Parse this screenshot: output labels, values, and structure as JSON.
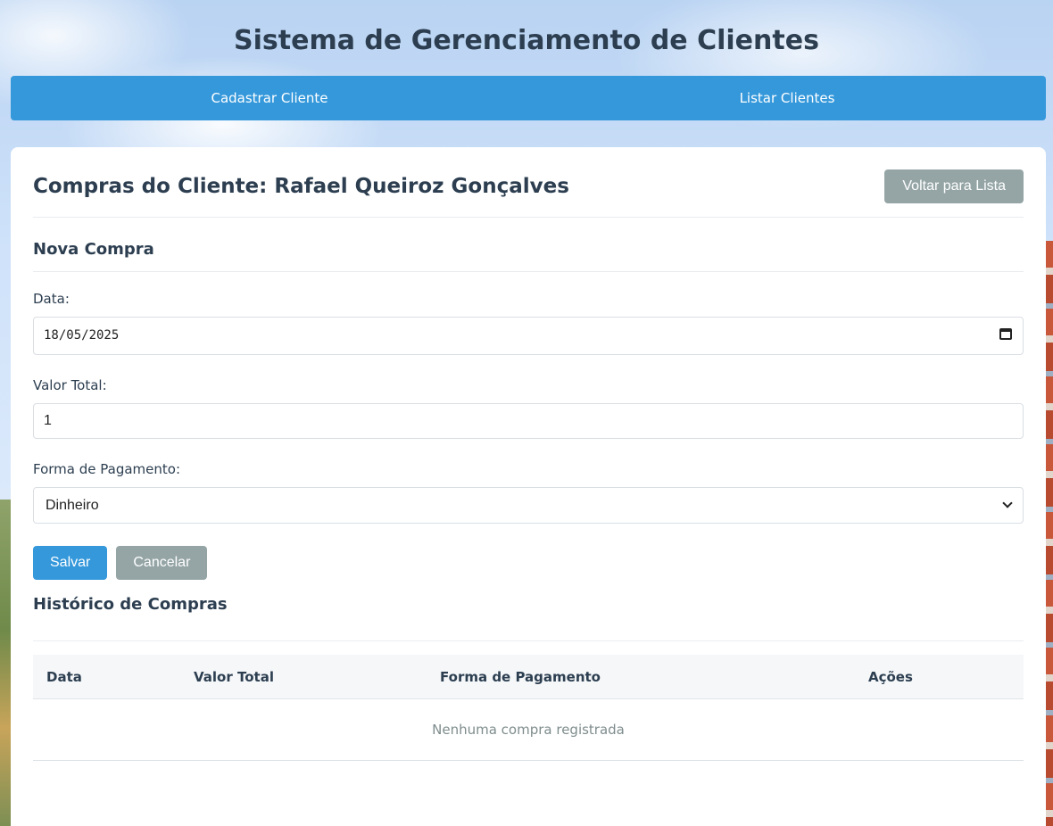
{
  "app": {
    "title": "Sistema de Gerenciamento de Clientes"
  },
  "nav": {
    "items": [
      {
        "label": "Cadastrar Cliente"
      },
      {
        "label": "Listar Clientes"
      }
    ]
  },
  "page": {
    "title": "Compras do Cliente: Rafael Queiroz Gonçalves",
    "back_button": "Voltar para Lista"
  },
  "form": {
    "title": "Nova Compra",
    "date_label": "Data:",
    "date_value": "18/05/2025",
    "total_label": "Valor Total:",
    "total_value": "1",
    "payment_label": "Forma de Pagamento:",
    "payment_value": "Dinheiro",
    "save_button": "Salvar",
    "cancel_button": "Cancelar"
  },
  "history": {
    "title": "Histórico de Compras",
    "columns": [
      "Data",
      "Valor Total",
      "Forma de Pagamento",
      "Ações"
    ],
    "empty_message": "Nenhuma compra registrada"
  },
  "colors": {
    "primary": "#3498db",
    "secondary": "#95a5a6",
    "text": "#2c3e50"
  },
  "icons": {
    "date_picker": "calendar-icon",
    "select": "chevron-down-icon"
  }
}
